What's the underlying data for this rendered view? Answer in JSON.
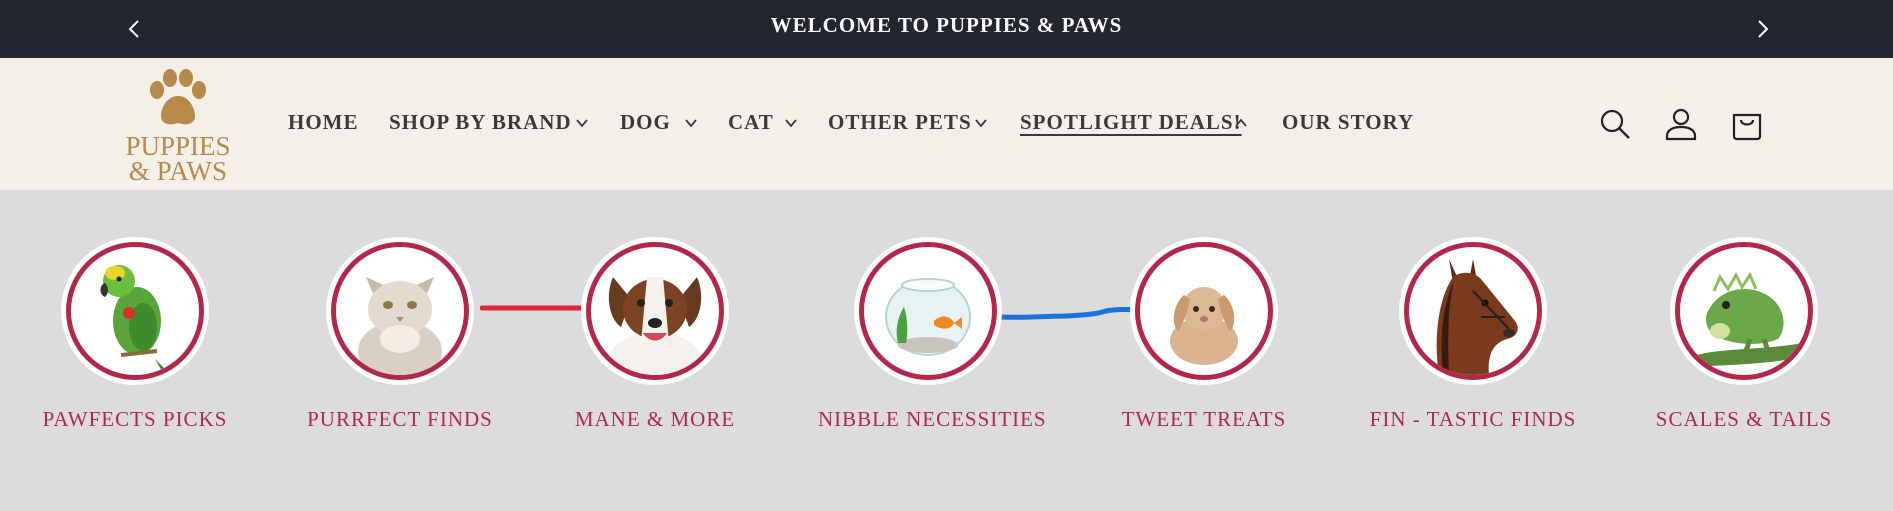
{
  "announcement": {
    "text": "WELCOME TO PUPPIES & PAWS",
    "prev_icon": "chevron-left-icon",
    "next_icon": "chevron-right-icon"
  },
  "logo": {
    "line1": "PUPPIES",
    "line2": "& PAWS",
    "icon": "paw-icon",
    "color": "#b88a4a"
  },
  "nav": {
    "items": [
      {
        "label": "HOME",
        "has_dropdown": false
      },
      {
        "label": "SHOP BY BRAND",
        "has_dropdown": true
      },
      {
        "label": "DOG",
        "has_dropdown": true
      },
      {
        "label": "CAT",
        "has_dropdown": true
      },
      {
        "label": "OTHER PETS",
        "has_dropdown": true
      },
      {
        "label": "SPOTLIGHT DEALS!",
        "has_dropdown": true,
        "active": true,
        "expanded": true
      },
      {
        "label": "OUR STORY",
        "has_dropdown": false
      }
    ]
  },
  "header_icons": [
    "search-icon",
    "account-icon",
    "cart-icon"
  ],
  "categories": [
    {
      "label": "PAWFECTS PICKS",
      "image": "parrot"
    },
    {
      "label": "PURRFECT FINDS",
      "image": "cat"
    },
    {
      "label": "MANE & MORE",
      "image": "dog"
    },
    {
      "label": "NIBBLE NECESSITIES",
      "image": "fishbowl"
    },
    {
      "label": "TWEET TREATS",
      "image": "rabbit"
    },
    {
      "label": "FIN - TASTIC FINDS",
      "image": "horse"
    },
    {
      "label": "SCALES & TAILS",
      "image": "iguana"
    }
  ],
  "colors": {
    "announcement_bg": "#23262f",
    "header_bg": "#f4f0e9",
    "page_bg": "#dcdcdc",
    "accent": "#b3284a",
    "connector_red": "#e0263c",
    "connector_blue": "#1a73d9"
  }
}
